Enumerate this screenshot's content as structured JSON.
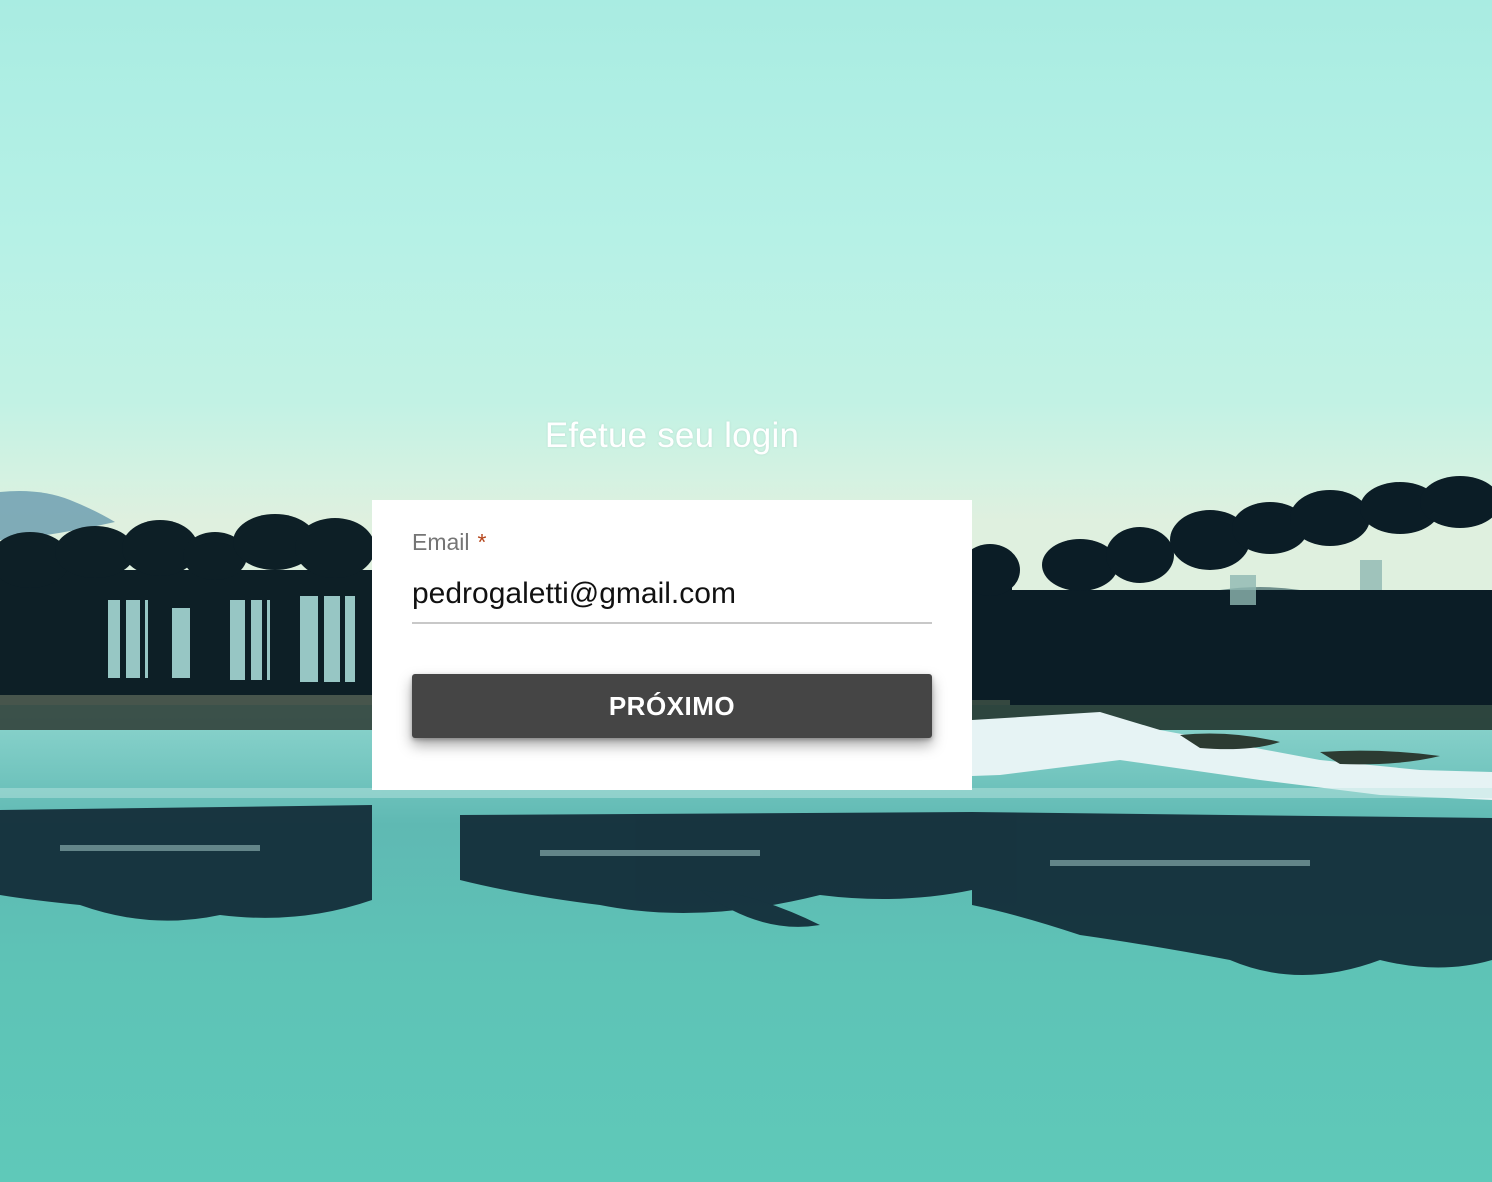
{
  "login": {
    "title": "Efetue seu login",
    "email_label": "Email",
    "required_marker": "*",
    "email_value": "pedrogaletti@gmail.com",
    "next_label": "PRÓXIMO"
  },
  "background": {
    "subject": "lake-with-trees-photo",
    "colors": {
      "sky_top": "#a9ece2",
      "sky_horizon": "#dff0df",
      "water": "#6fc8bc",
      "trees": "#0b1d26"
    }
  }
}
